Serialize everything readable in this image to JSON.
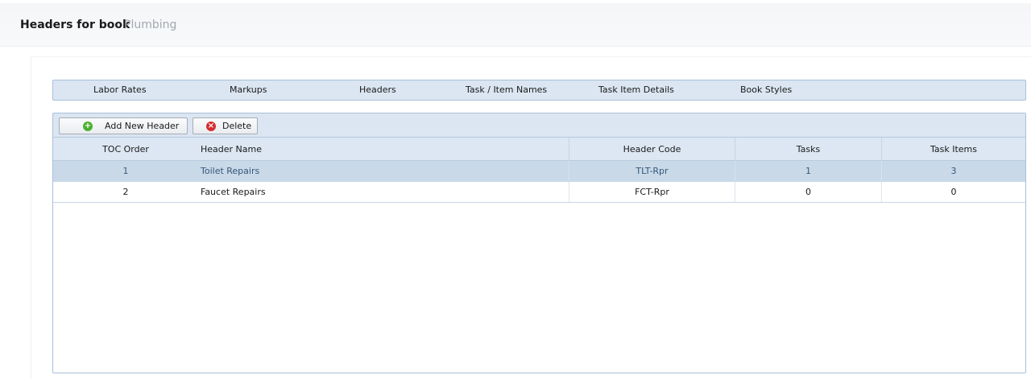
{
  "header": {
    "title": "Headers for book",
    "subtitle": "Plumbing"
  },
  "tabs": [
    {
      "label": "Labor Rates"
    },
    {
      "label": "Markups"
    },
    {
      "label": "Headers"
    },
    {
      "label": "Task / Item Names"
    },
    {
      "label": "Task Item Details"
    },
    {
      "label": "Book Styles"
    }
  ],
  "toolbar": {
    "add_label": "Add New Header",
    "add_icon": "add-circle-icon",
    "add_icon_color": "#4caf2f",
    "delete_label": "Delete",
    "delete_icon": "delete-circle-icon",
    "delete_icon_color": "#d32f2f"
  },
  "grid": {
    "columns": [
      "TOC Order",
      "Header Name",
      "Header Code",
      "Tasks",
      "Task Items"
    ],
    "rows": [
      {
        "toc_order": "1",
        "name": "Toilet Repairs",
        "code": "TLT-Rpr",
        "tasks": "1",
        "task_items": "3",
        "selected": true
      },
      {
        "toc_order": "2",
        "name": "Faucet Repairs",
        "code": "FCT-Rpr",
        "tasks": "0",
        "task_items": "0",
        "selected": false
      }
    ]
  },
  "colors": {
    "panel_bg": "#dbe6f2",
    "panel_border": "#a9c0d8",
    "selected_row": "#c9d9e8"
  }
}
